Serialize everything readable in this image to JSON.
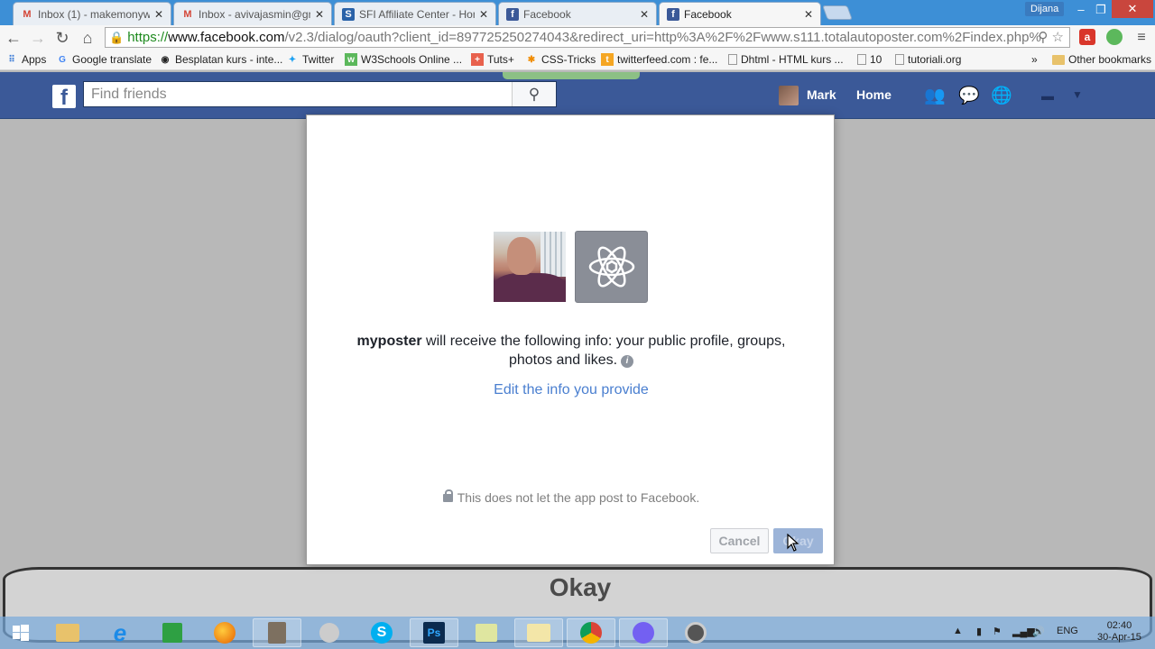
{
  "browser": {
    "tabs": [
      {
        "title": "Inbox (1) - makemonywith",
        "icon": "gmail-icon"
      },
      {
        "title": "Inbox - avivajasmin@gma",
        "icon": "gmail-icon"
      },
      {
        "title": "SFI Affiliate Center - Hom",
        "icon": "sfi-icon"
      },
      {
        "title": "Facebook",
        "icon": "facebook-icon"
      },
      {
        "title": "Facebook",
        "icon": "facebook-icon"
      }
    ],
    "window_user": "Dijana",
    "url": {
      "scheme": "https://",
      "host": "www.facebook.com",
      "path": "/v2.3/dialog/oauth?client_id=897725250274043&redirect_uri=http%3A%2F%2Fwww.s111.totalautoposter.com%2Findex.php%"
    },
    "bookmarks": [
      {
        "label": "Apps",
        "icon": "apps-grid-icon"
      },
      {
        "label": "Google translate",
        "icon": "google-icon"
      },
      {
        "label": "Besplatan kurs - inte...",
        "icon": "eye-icon"
      },
      {
        "label": "Twitter",
        "icon": "twitter-icon"
      },
      {
        "label": "W3Schools Online ...",
        "icon": "w3schools-icon"
      },
      {
        "label": "Tuts+",
        "icon": "tuts-icon"
      },
      {
        "label": "CSS-Tricks",
        "icon": "css-tricks-icon"
      },
      {
        "label": "twitterfeed.com : fe...",
        "icon": "twitterfeed-icon"
      },
      {
        "label": "Dhtml - HTML kurs ...",
        "icon": "page-icon"
      },
      {
        "label": "10",
        "icon": "page-icon"
      },
      {
        "label": "tutoriali.org",
        "icon": "page-icon"
      }
    ],
    "bookmarks_more": "»",
    "other_bookmarks": "Other bookmarks"
  },
  "facebook": {
    "search_placeholder": "Find friends",
    "user_name": "Mark",
    "home_label": "Home"
  },
  "dialog": {
    "app_name": "myposter",
    "message_rest_line1": " will receive the following info: your public profile, groups,",
    "message_line2": "photos and likes.",
    "info_glyph": "i",
    "edit_link": "Edit the info you provide",
    "notice": "This does not let the app post to Facebook.",
    "cancel_label": "Cancel",
    "okay_label": "Okay"
  },
  "caption": {
    "text": "Okay"
  },
  "taskbar": {
    "lang": "ENG",
    "time": "02:40",
    "date": "30-Apr-15"
  }
}
